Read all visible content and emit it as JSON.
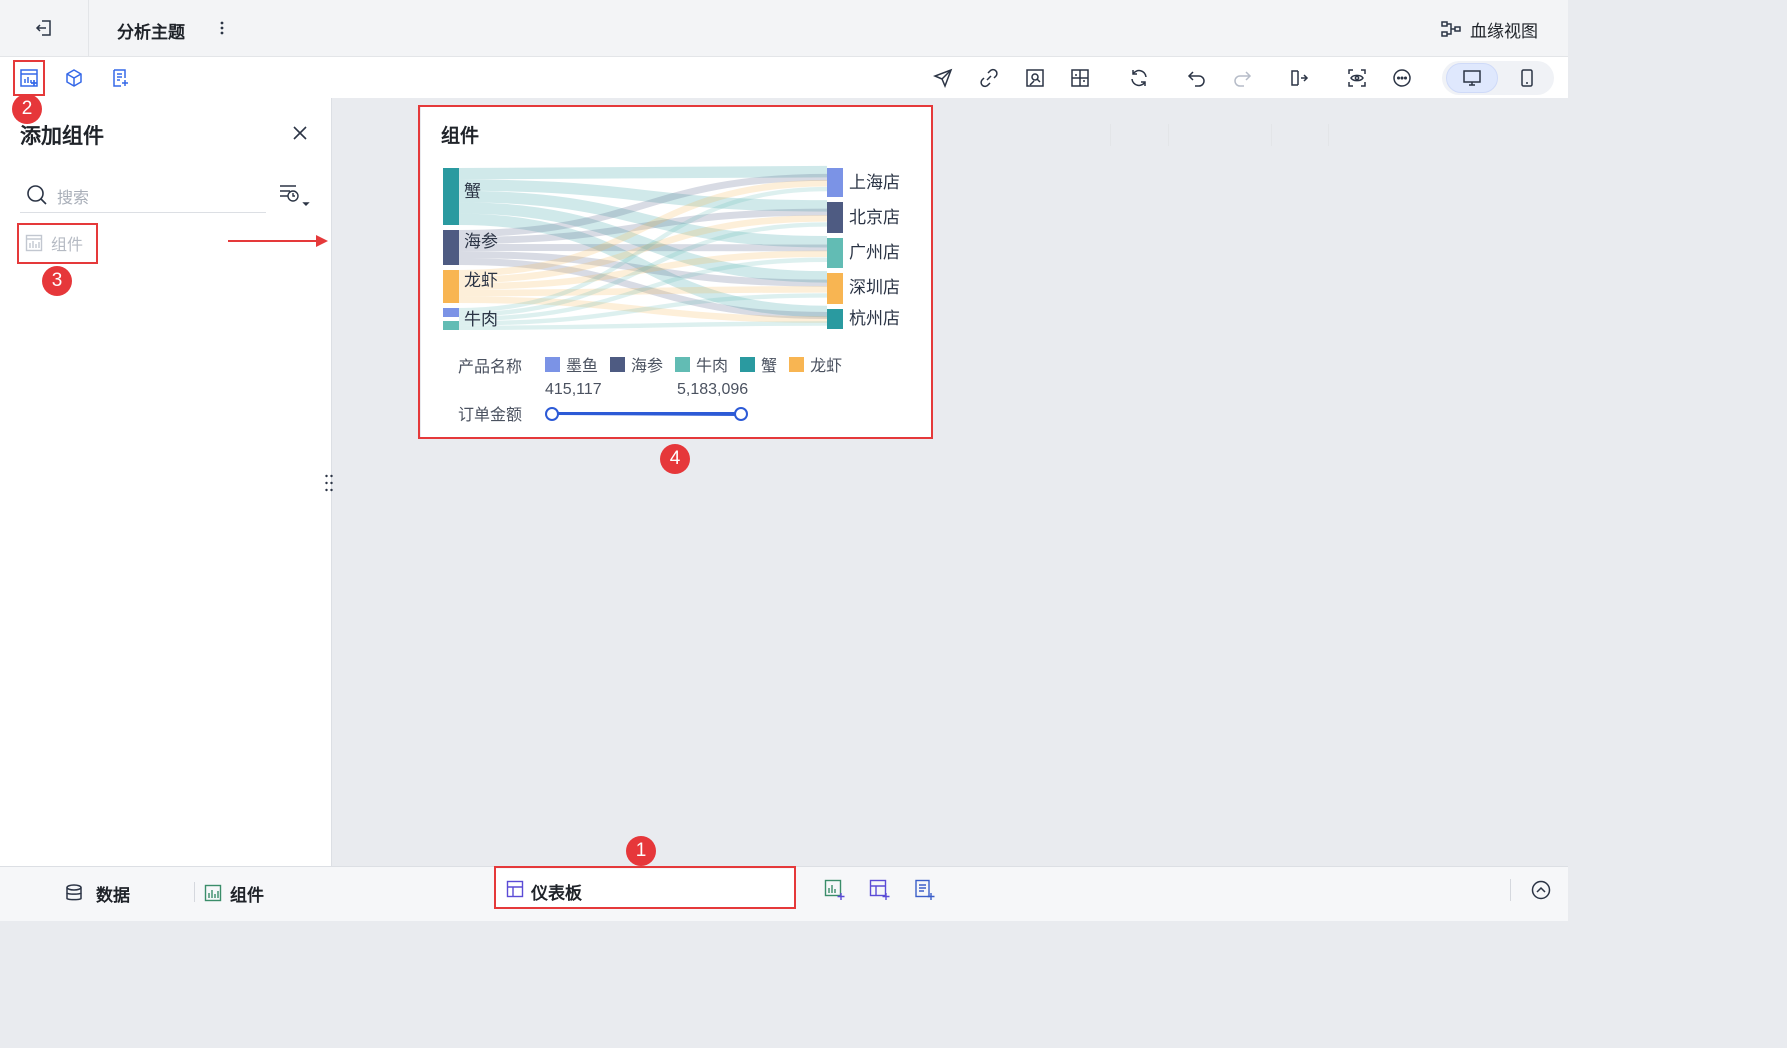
{
  "topbar": {
    "title": "分析主题",
    "lineage_label": "血缘视图"
  },
  "panel": {
    "title": "添加组件",
    "search_placeholder": "搜索",
    "items": [
      {
        "label": "组件"
      }
    ]
  },
  "widget": {
    "title": "组件",
    "legend_title": "产品名称",
    "legend": [
      {
        "name": "墨鱼",
        "color": "#7b93e6"
      },
      {
        "name": "海参",
        "color": "#4e5b82"
      },
      {
        "name": "牛肉",
        "color": "#62bcb4"
      },
      {
        "name": "蟹",
        "color": "#2a9aa0"
      },
      {
        "name": "龙虾",
        "color": "#f8b552"
      }
    ],
    "range_label": "订单金额",
    "range_min": "415,117",
    "range_max": "5,183,096"
  },
  "chart_data": {
    "type": "sankey",
    "sources": [
      "蟹",
      "海参",
      "龙虾",
      "牛肉",
      "墨鱼"
    ],
    "targets": [
      "上海店",
      "北京店",
      "广州店",
      "深圳店",
      "杭州店"
    ],
    "source_colors": [
      "#2a9aa0",
      "#4e5b82",
      "#f8b552",
      "#62bcb4",
      "#7b93e6"
    ],
    "target_colors": [
      "#7b93e6",
      "#4e5b82",
      "#62bcb4",
      "#f8b552",
      "#2a9aa0"
    ]
  },
  "bottombar": {
    "data_label": "数据",
    "widget_label": "组件",
    "dashboard_label": "仪表板"
  },
  "annotations": [
    "1",
    "2",
    "3",
    "4"
  ]
}
